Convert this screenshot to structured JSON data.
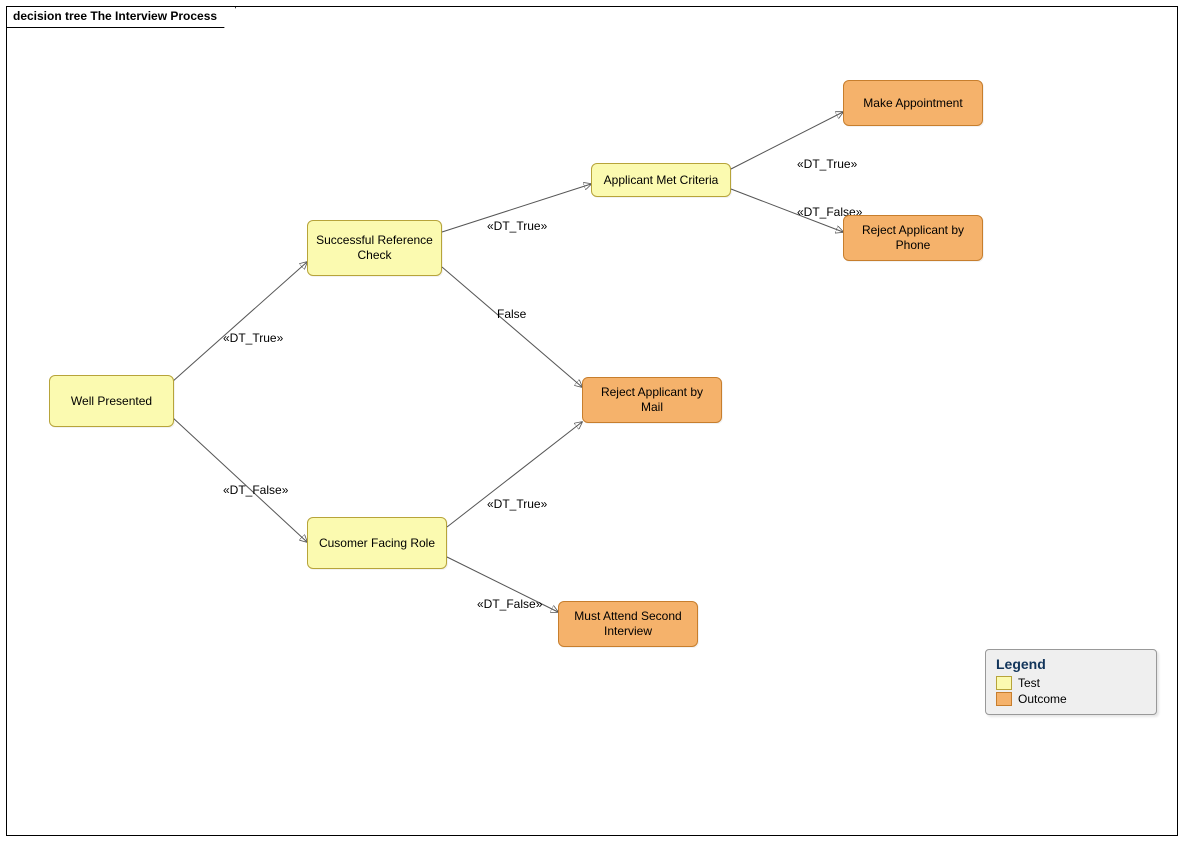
{
  "frame": {
    "title": "decision tree The Interview Process"
  },
  "nodes": {
    "well_presented": "Well Presented",
    "successful_ref": "Successful Reference Check",
    "cust_facing": "Cusomer Facing Role",
    "met_criteria": "Applicant Met Criteria",
    "make_appt": "Make Appointment",
    "reject_phone": "Reject Applicant by Phone",
    "reject_mail": "Reject Applicant by Mail",
    "second_interview": "Must Attend Second Interview"
  },
  "labels": {
    "dt_true": "«DT_True»",
    "dt_false": "«DT_False»",
    "false_plain": "False"
  },
  "legend": {
    "title": "Legend",
    "items": [
      {
        "name": "Test"
      },
      {
        "name": "Outcome"
      }
    ]
  }
}
